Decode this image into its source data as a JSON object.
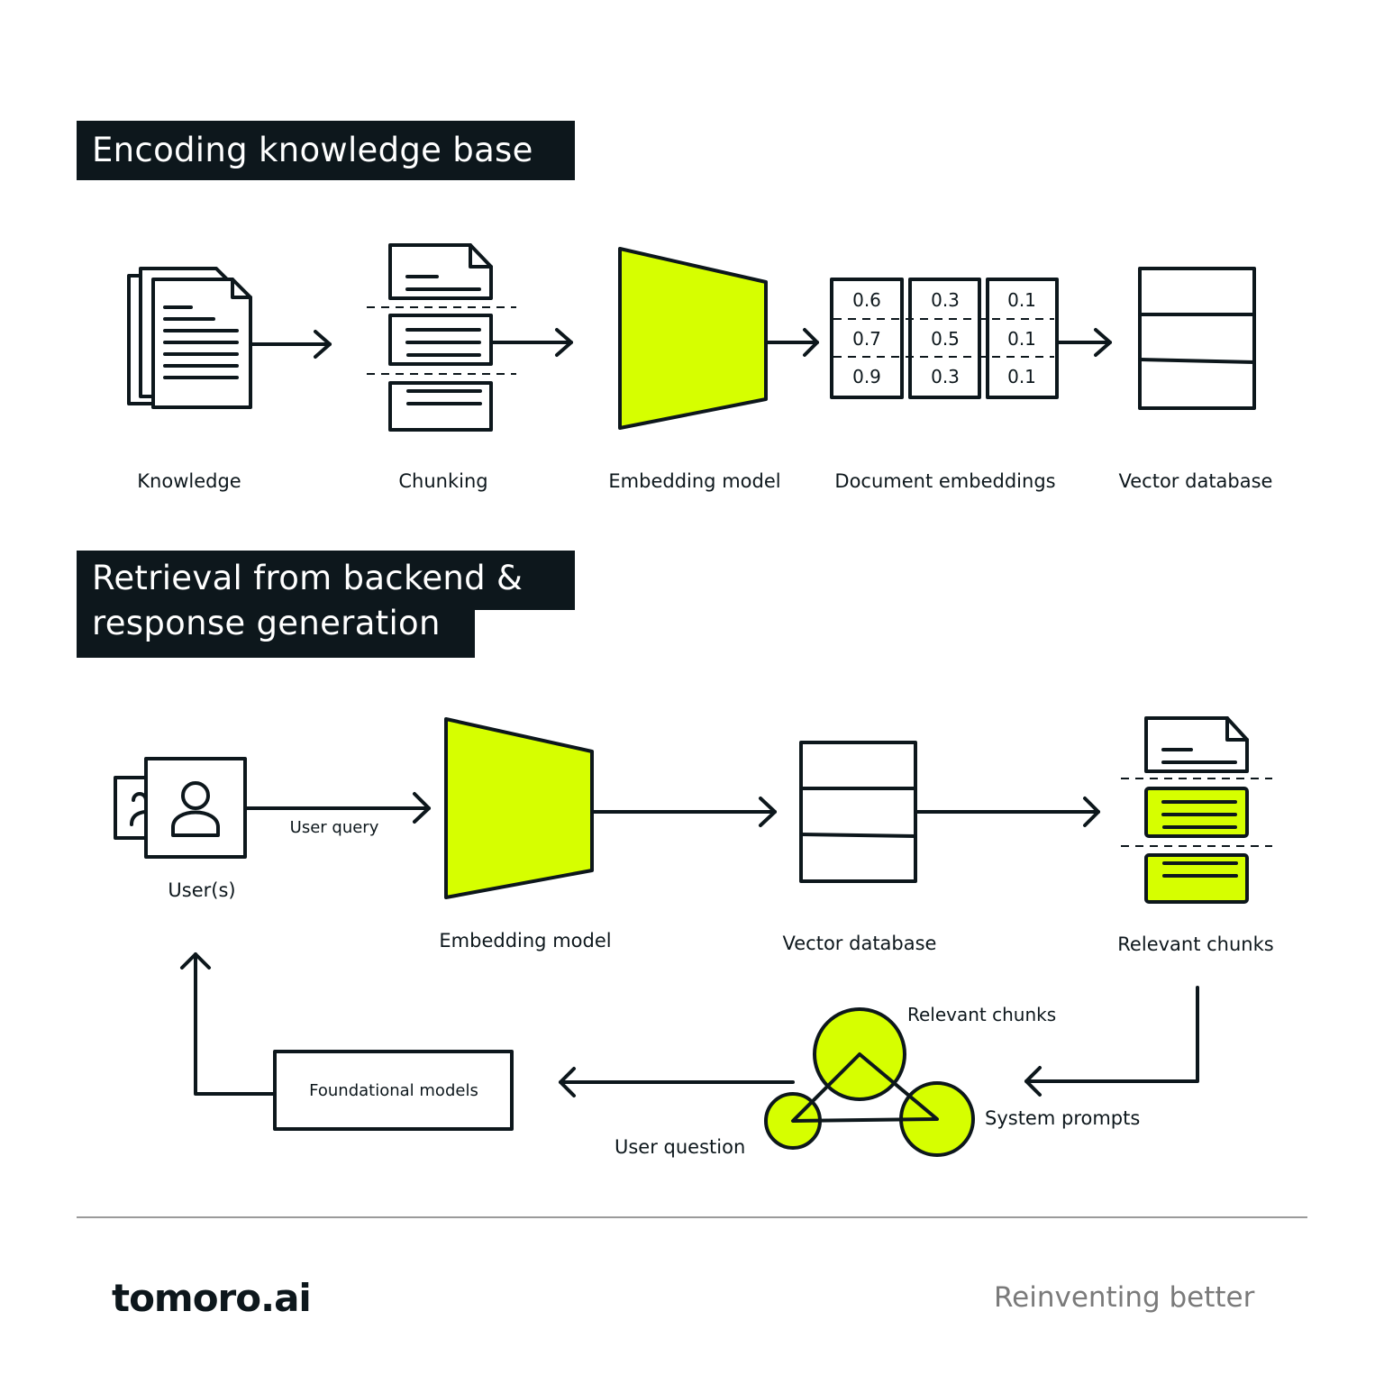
{
  "colors": {
    "accent": "#d6ff00",
    "ink": "#0d171c",
    "muted": "#7a7a7a",
    "divider": "#9a9a9a"
  },
  "section1": {
    "title": "Encoding knowledge base",
    "steps": [
      {
        "label": "Knowledge",
        "icon": "stacked-documents-icon"
      },
      {
        "label": "Chunking",
        "icon": "chunked-document-icon"
      },
      {
        "label": "Embedding model",
        "icon": "embedding-model-trapezoid-icon"
      },
      {
        "label": "Document embeddings",
        "icon": "embedding-vectors-icon"
      },
      {
        "label": "Vector database",
        "icon": "vector-database-icon"
      }
    ],
    "embeddings": [
      [
        "0.6",
        "0.7",
        "0.9"
      ],
      [
        "0.3",
        "0.5",
        "0.3"
      ],
      [
        "0.1",
        "0.1",
        "0.1"
      ]
    ]
  },
  "section2": {
    "title_line1": "Retrieval from backend &",
    "title_line2": "response generation",
    "users_label": "User(s)",
    "user_query_label": "User query",
    "embedding_model_label": "Embedding model",
    "vector_database_label": "Vector database",
    "relevant_chunks_label": "Relevant chunks",
    "foundational_models_label": "Foundational models",
    "prompt_parts": {
      "relevant_chunks": "Relevant chunks",
      "system_prompts": "System prompts",
      "user_question": "User question"
    }
  },
  "footer": {
    "logo": "tomoro.ai",
    "tagline": "Reinventing better"
  }
}
